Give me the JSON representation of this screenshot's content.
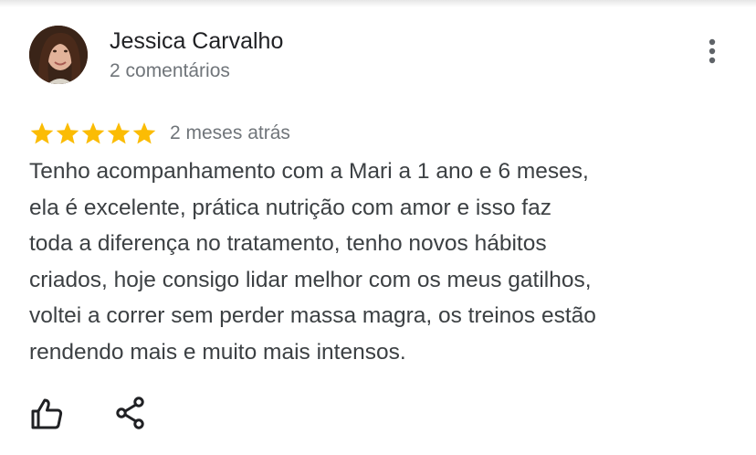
{
  "review": {
    "author_name": "Jessica Carvalho",
    "author_meta": "2 comentários",
    "rating": 5,
    "rating_max": 5,
    "date": "2 meses atrás",
    "text_lines": [
      "Tenho acompanhamento com a Mari a 1 ano e 6 meses,",
      "ela é excelente, prática nutrição com amor e isso faz",
      "toda a diferença no tratamento, tenho novos hábitos",
      "criados, hoje consigo lidar melhor com os meus gatilhos,",
      "voltei a correr sem perder massa magra, os treinos estão",
      "rendendo mais e muito mais intensos."
    ]
  },
  "icons": {
    "avatar": "user-photo",
    "menu": "more-vert-icon",
    "star": "star-icon",
    "like": "thumb-up-icon",
    "share": "share-icon"
  },
  "colors": {
    "star": "#fbbc04",
    "name": "#202124",
    "meta": "#70757a",
    "body_text": "#3c4043",
    "icon": "#202124"
  }
}
